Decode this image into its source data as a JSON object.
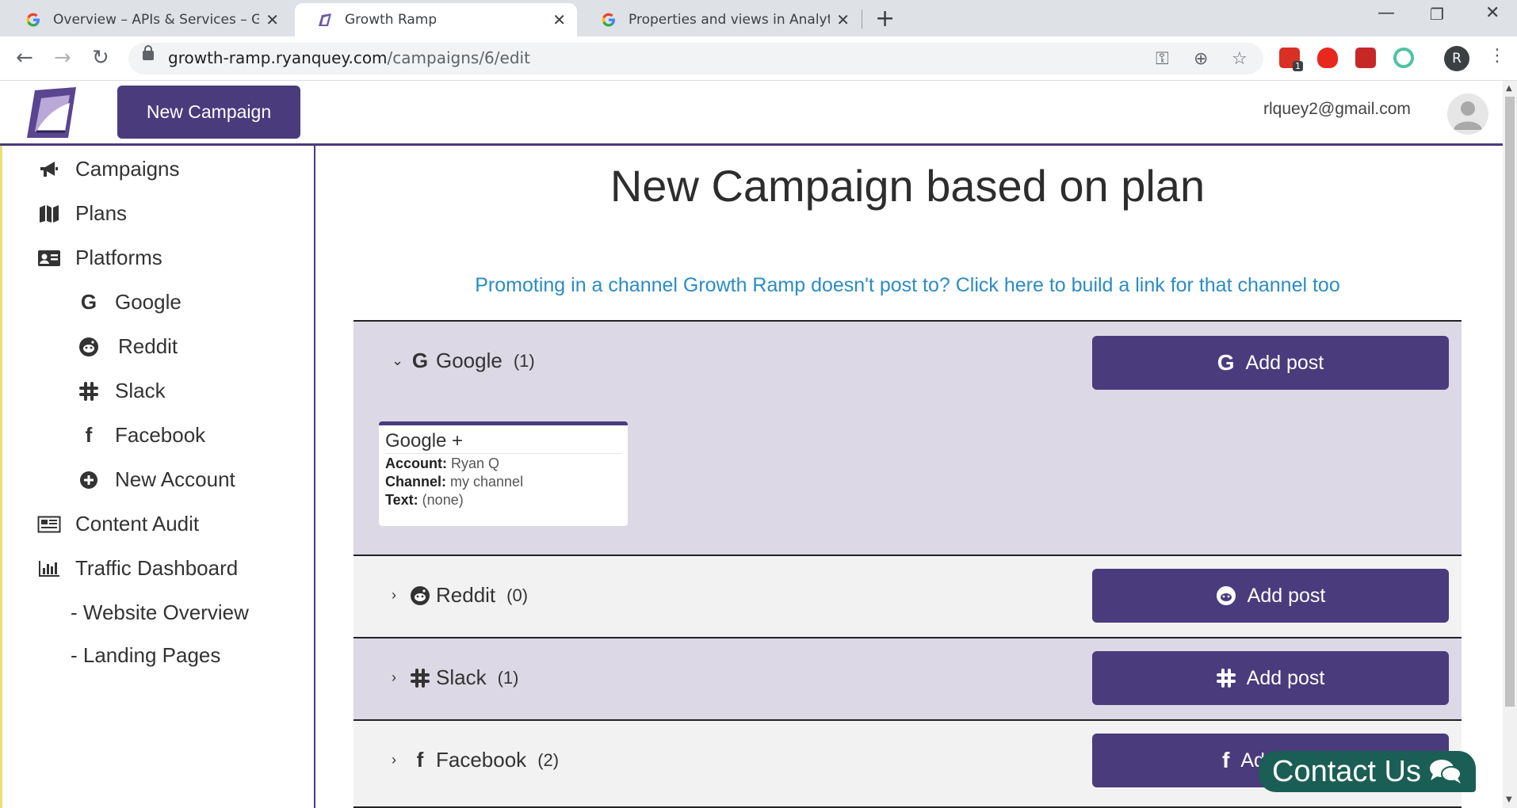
{
  "browser": {
    "tabs": [
      {
        "title": "Overview – APIs & Services – Gro",
        "active": false
      },
      {
        "title": "Growth Ramp",
        "active": true
      },
      {
        "title": "Properties and views in Analytics",
        "active": false
      }
    ],
    "url_host": "growth-ramp.ryanquey.com",
    "url_path": "/campaigns/6/edit",
    "profile_initial": "R",
    "ext_badge": "1"
  },
  "header": {
    "new_campaign_label": "New Campaign",
    "user_email": "rlquey2@gmail.com"
  },
  "sidebar": {
    "items": [
      {
        "label": "Campaigns",
        "icon": "bullhorn-icon"
      },
      {
        "label": "Plans",
        "icon": "map-icon"
      },
      {
        "label": "Platforms",
        "icon": "id-card-icon"
      },
      {
        "label": "Google",
        "icon": "google-icon"
      },
      {
        "label": "Reddit",
        "icon": "reddit-icon"
      },
      {
        "label": "Slack",
        "icon": "slack-icon"
      },
      {
        "label": "Facebook",
        "icon": "facebook-icon"
      },
      {
        "label": "New Account",
        "icon": "plus-circle-icon"
      },
      {
        "label": "Content Audit",
        "icon": "newspaper-icon"
      },
      {
        "label": "Traffic Dashboard",
        "icon": "bar-chart-icon"
      },
      {
        "label": "- Website Overview"
      },
      {
        "label": "- Landing Pages"
      }
    ]
  },
  "main": {
    "title": "New Campaign based on plan",
    "channel_link": "Promoting in a channel Growth Ramp doesn't post to? Click here to build a link for that channel too",
    "add_post_label": "Add post",
    "platforms": [
      {
        "name": "Google",
        "count": "(1)",
        "expanded": true
      },
      {
        "name": "Reddit",
        "count": "(0)",
        "expanded": false
      },
      {
        "name": "Slack",
        "count": "(1)",
        "expanded": false
      },
      {
        "name": "Facebook",
        "count": "(2)",
        "expanded": false
      }
    ],
    "post_card": {
      "title": "Google +",
      "account_label": "Account:",
      "account_value": " Ryan Q",
      "channel_label": "Channel:",
      "channel_value": " my channel",
      "text_label": "Text:",
      "text_value": " (none)"
    }
  },
  "contact_us_label": "Contact Us",
  "colors": {
    "brand": "#4a3b7d",
    "link": "#2b8cc4",
    "contact": "#1b5e55"
  }
}
